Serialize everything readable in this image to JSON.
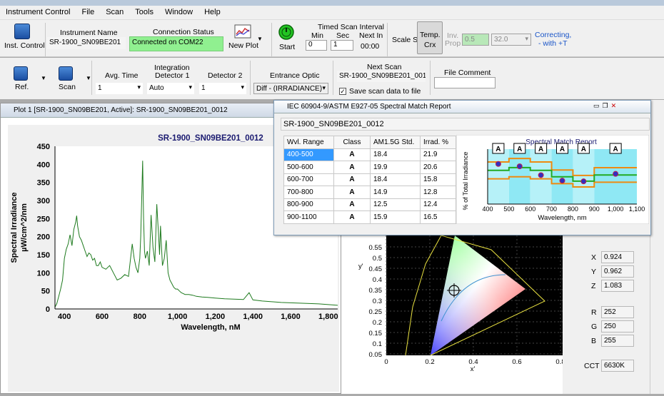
{
  "menu": [
    "Instrument Control",
    "File",
    "Scan",
    "Tools",
    "Window",
    "Help"
  ],
  "toolbar1": {
    "inst_control_label": "Inst. Control",
    "instrument_name_label": "Instrument Name",
    "instrument_name_value": "SR-1900_SN09BE201",
    "connection_status_label": "Connection Status",
    "connection_status_value": "Connected on COM22",
    "new_plot_label": "New Plot",
    "start_label": "Start",
    "timed_scan_label": "Timed Scan Interval",
    "min_label": "Min",
    "min_value": "0",
    "sec_label": "Sec",
    "sec_value": "1",
    "next_in_label": "Next In",
    "next_in_value": "00:00",
    "scale_si_label": "Scale Si",
    "temp_label": "Temp.",
    "crx_label": "Crx",
    "inv_label": "Inv.",
    "prop_label": "Prop",
    "inv_value1": "0.5",
    "inv_value2": "32.0",
    "correcting_label": "Correcting,",
    "with_t_label": "- with +T"
  },
  "toolbar2": {
    "ref_label": "Ref.",
    "scan_label": "Scan",
    "avg_time_label": "Avg. Time",
    "avg_time_value": "1",
    "integration_label": "Integration",
    "detector1_label": "Detector 1",
    "detector1_value": "Auto",
    "detector2_label": "Detector 2",
    "detector2_value": "1",
    "entrance_optic_label": "Entrance Optic",
    "entrance_optic_value": "Diff - (IRRADIANCE)",
    "next_scan_label": "Next Scan",
    "next_scan_value": "SR-1900_SN09BE201_0013",
    "save_label": "Save scan data to file",
    "file_comment_label": "File Comment"
  },
  "plot1": {
    "window_title": "Plot 1 [SR-1900_SN09BE201, Active]: SR-1900_SN09BE201_0012"
  },
  "report": {
    "window_title": "IEC 60904-9/ASTM E927-05 Spectral Match Report",
    "scan_name": "SR-1900_SN09BE201_0012",
    "headers": [
      "Wvl. Range",
      "Class",
      "AM1.5G Std.",
      "Irrad. %"
    ],
    "rows": [
      {
        "range": "400-500",
        "cls": "A",
        "std": "18.4",
        "irr": "21.9"
      },
      {
        "range": "500-600",
        "cls": "A",
        "std": "19.9",
        "irr": "20.6"
      },
      {
        "range": "600-700",
        "cls": "A",
        "std": "18.4",
        "irr": "15.8"
      },
      {
        "range": "700-800",
        "cls": "A",
        "std": "14.9",
        "irr": "12.8"
      },
      {
        "range": "800-900",
        "cls": "A",
        "std": "12.5",
        "irr": "12.4"
      },
      {
        "range": "900-1100",
        "cls": "A",
        "std": "15.9",
        "irr": "16.5"
      }
    ]
  },
  "cie_values": {
    "X": "0.924",
    "Y": "0.962",
    "Z": "1.083",
    "R": "252",
    "G": "250",
    "B": "255",
    "CCT": "6630K"
  },
  "chart_data": [
    {
      "type": "line",
      "title": "SR-1900_SN09BE201_0012",
      "xlabel": "Wavelength, nM",
      "ylabel": "Spectral Irradiance µW/cm^2/nm",
      "xlim": [
        350,
        1850
      ],
      "ylim": [
        0,
        450
      ],
      "xticks": [
        "400",
        "600",
        "800",
        "1,000",
        "1,200",
        "1,400",
        "1,600",
        "1,800"
      ],
      "yticks": [
        "0",
        "50",
        "100",
        "150",
        "200",
        "250",
        "300",
        "350",
        "400",
        "450"
      ],
      "color": "#1e7a1e",
      "x": [
        350,
        360,
        370,
        380,
        390,
        400,
        410,
        420,
        430,
        440,
        450,
        460,
        465,
        470,
        480,
        490,
        500,
        510,
        520,
        530,
        540,
        550,
        560,
        570,
        580,
        590,
        600,
        620,
        640,
        660,
        680,
        700,
        720,
        740,
        760,
        770,
        780,
        790,
        800,
        805,
        810,
        815,
        820,
        825,
        830,
        840,
        850,
        860,
        870,
        880,
        890,
        900,
        905,
        910,
        920,
        930,
        940,
        950,
        960,
        970,
        980,
        990,
        1000,
        1010,
        1020,
        1040,
        1060,
        1080,
        1100,
        1130,
        1160,
        1200,
        1250,
        1300,
        1350,
        1380,
        1400,
        1450,
        1500,
        1550,
        1600,
        1650,
        1700,
        1750,
        1800,
        1850
      ],
      "y": [
        5,
        15,
        35,
        55,
        80,
        140,
        165,
        180,
        205,
        175,
        220,
        240,
        258,
        230,
        200,
        190,
        175,
        160,
        145,
        155,
        150,
        135,
        140,
        120,
        120,
        130,
        115,
        110,
        120,
        100,
        80,
        85,
        95,
        90,
        180,
        140,
        115,
        100,
        140,
        200,
        300,
        410,
        250,
        160,
        140,
        160,
        120,
        260,
        170,
        130,
        290,
        200,
        150,
        230,
        120,
        140,
        190,
        100,
        80,
        70,
        60,
        55,
        55,
        50,
        45,
        40,
        40,
        38,
        35,
        33,
        32,
        30,
        28,
        27,
        26,
        45,
        25,
        22,
        20,
        18,
        17,
        16,
        15,
        14,
        12,
        10
      ]
    },
    {
      "type": "bar",
      "title": "Spectral Match Report",
      "xlabel": "Wavelength, nm",
      "ylabel": "% of Total Irradiance",
      "xticks": [
        "400",
        "500",
        "600",
        "700",
        "800",
        "900",
        "1,000",
        "1,100"
      ],
      "categories": [
        "400-500",
        "500-600",
        "600-700",
        "700-800",
        "800-900",
        "900-1100"
      ],
      "class_labels": [
        "A",
        "A",
        "A",
        "A",
        "A",
        "A"
      ],
      "values": [
        21.9,
        20.6,
        15.8,
        12.8,
        12.4,
        16.5
      ],
      "reference": [
        18.4,
        19.9,
        18.4,
        14.9,
        12.5,
        15.9
      ]
    }
  ]
}
